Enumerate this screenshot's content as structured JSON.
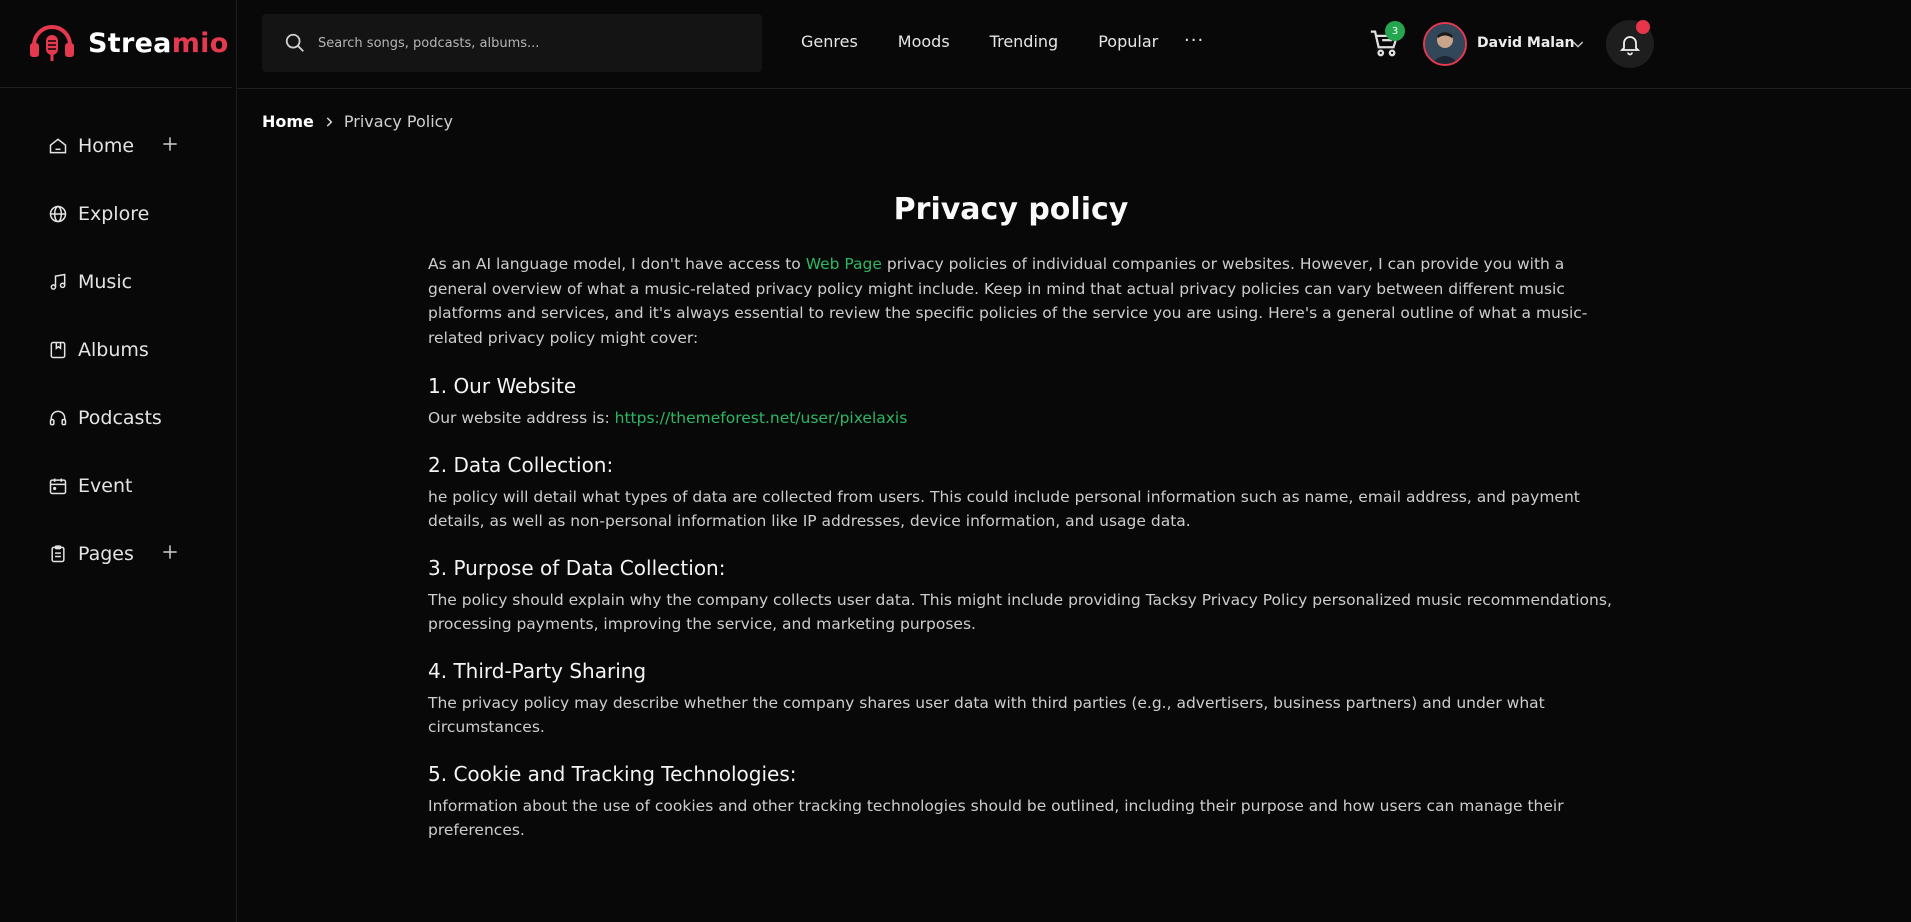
{
  "brand": {
    "name_main": "Strea",
    "name_accent": "mio",
    "accent_color": "#e53950",
    "logo_icon": "headphones-mic-icon"
  },
  "sidebar": {
    "items": [
      {
        "label": "Home",
        "icon": "home-icon",
        "expandable": true
      },
      {
        "label": "Explore",
        "icon": "globe-icon",
        "expandable": false
      },
      {
        "label": "Music",
        "icon": "music-note-icon",
        "expandable": false
      },
      {
        "label": "Albums",
        "icon": "album-icon",
        "expandable": false
      },
      {
        "label": "Podcasts",
        "icon": "headphones-icon",
        "expandable": false
      },
      {
        "label": "Event",
        "icon": "calendar-icon",
        "expandable": false
      },
      {
        "label": "Pages",
        "icon": "clipboard-icon",
        "expandable": true
      }
    ]
  },
  "header": {
    "search_placeholder": "Search songs, podcasts, albums...",
    "nav": [
      "Genres",
      "Moods",
      "Trending",
      "Popular"
    ],
    "more": "···",
    "cart_count": "3",
    "user_name": "David Malan"
  },
  "breadcrumb": {
    "home": "Home",
    "current": "Privacy Policy"
  },
  "page": {
    "title": "Privacy policy",
    "intro_before": "As an AI language model, I don't have access to ",
    "intro_link": "Web Page",
    "intro_after": " privacy policies of individual companies or websites. However, I can provide you with a general overview of what a music-related privacy policy might include. Keep in mind that actual privacy policies can vary between different music platforms and services, and it's always essential to review the specific policies of the service you are using. Here's a general outline of what a music-related privacy policy might cover:",
    "s1_heading": "1. Our Website",
    "s1_text": "Our website address is: ",
    "s1_link": "https://themeforest.net/user/pixelaxis",
    "s2_heading": "2. Data Collection:",
    "s2_text": "he policy will detail what types of data are collected from users. This could include personal information such as name, email address, and payment details, as well as non-personal information like IP addresses, device information, and usage data.",
    "s3_heading": "3. Purpose of Data Collection:",
    "s3_text": "The policy should explain why the company collects user data. This might include providing Tacksy Privacy Policy personalized music recommendations, processing payments, improving the service, and marketing purposes.",
    "s4_heading": "4. Third-Party Sharing",
    "s4_text": "The privacy policy may describe whether the company shares user data with third parties (e.g., advertisers, business partners) and under what circumstances.",
    "s5_heading": "5. Cookie and Tracking Technologies:",
    "s5_text": "Information about the use of cookies and other tracking technologies should be outlined, including their purpose and how users can manage their preferences."
  },
  "colors": {
    "background": "#080808",
    "link_green": "#2cb863",
    "badge_green": "#25a550",
    "notification_red": "#e8354a"
  }
}
